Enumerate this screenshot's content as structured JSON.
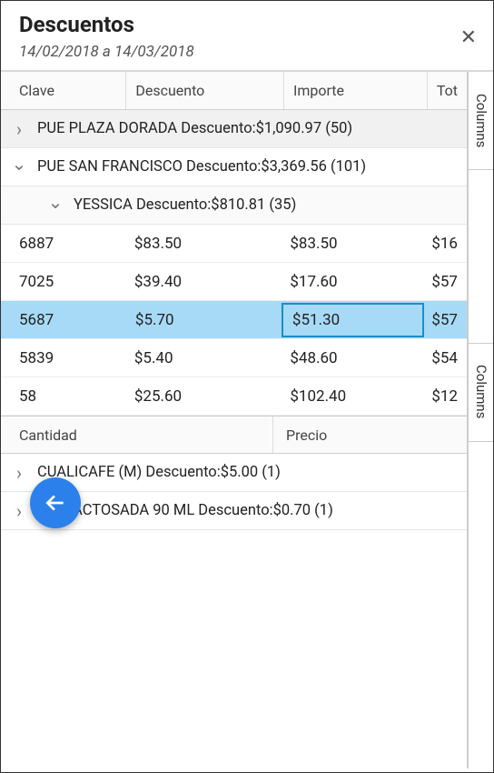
{
  "header": {
    "title": "Descuentos",
    "date_range": "14/02/2018 a 14/03/2018"
  },
  "columns_top": {
    "c1": "Clave",
    "c2": "Descuento",
    "c3": "Importe",
    "c4": "Tot"
  },
  "groups": {
    "g1": "PUE PLAZA DORADA Descuento:$1,090.97 (50)",
    "g2": "PUE SAN FRANCISCO Descuento:$3,369.56 (101)",
    "g2_sub": "YESSICA Descuento:$810.81 (35)"
  },
  "rows": [
    {
      "clave": "6887",
      "descuento": "$83.50",
      "importe": "$83.50",
      "total": "$16"
    },
    {
      "clave": "7025",
      "descuento": "$39.40",
      "importe": "$17.60",
      "total": "$57"
    },
    {
      "clave": "5687",
      "descuento": "$5.70",
      "importe": "$51.30",
      "total": "$57"
    },
    {
      "clave": "5839",
      "descuento": "$5.40",
      "importe": "$48.60",
      "total": "$54"
    },
    {
      "clave": "58",
      "descuento": "$25.60",
      "importe": "$102.40",
      "total": "$12"
    }
  ],
  "columns_bottom": {
    "a": "Cantidad",
    "b": "Precio"
  },
  "groups_bottom": {
    "b1": "CUALICAFE (M) Descuento:$5.00 (1)",
    "b2": "DESLACTOSADA 90 ML Descuento:$0.70 (1)"
  },
  "side_label": "Columns",
  "chart_data": {
    "type": "table",
    "columns": [
      "Clave",
      "Descuento",
      "Importe",
      "Total"
    ],
    "rows": [
      [
        "6887",
        83.5,
        83.5,
        null
      ],
      [
        "7025",
        39.4,
        17.6,
        null
      ],
      [
        "5687",
        5.7,
        51.3,
        null
      ],
      [
        "5839",
        5.4,
        48.6,
        null
      ],
      [
        "58",
        25.6,
        102.4,
        null
      ]
    ],
    "group_summaries": [
      {
        "name": "PUE PLAZA DORADA",
        "descuento": 1090.97,
        "count": 50
      },
      {
        "name": "PUE SAN FRANCISCO",
        "descuento": 3369.56,
        "count": 101
      },
      {
        "name": "YESSICA",
        "descuento": 810.81,
        "count": 35
      }
    ]
  }
}
